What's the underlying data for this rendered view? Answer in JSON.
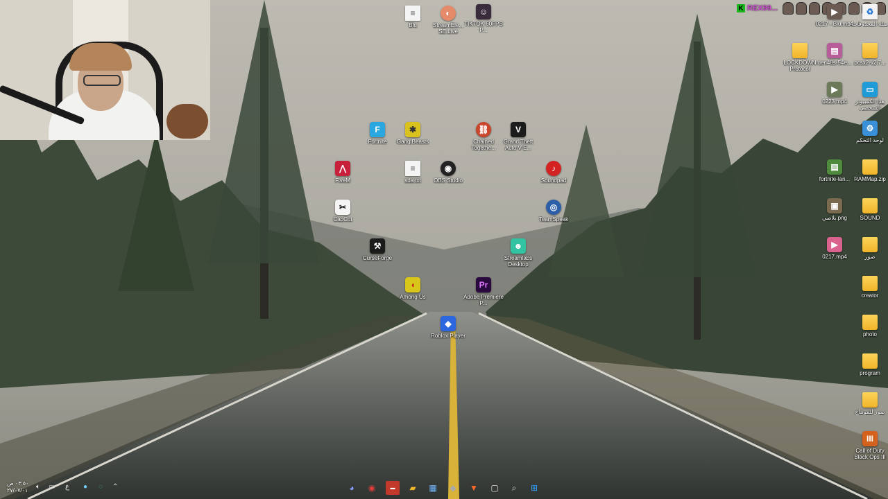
{
  "overlay": {
    "username": "REX99...",
    "badge": "K"
  },
  "desktop_icons": {
    "blu": "Blu",
    "streamelements": "StreamEle... SE.Live",
    "tiktok": "TIKTOK 60FPS P...",
    "fortnite": "Fortnite",
    "gang_beasts": "Gang Beasts",
    "chained": "Chained Togethe...",
    "gta": "Grand Theft Auto V E...",
    "fivem": "FiveM",
    "sda": "sda.txt",
    "obs": "OBS Studio",
    "soundpad": "Soundpad",
    "capcut": "CapCut",
    "teamspeak": "TeamSpeak",
    "curseforge": "CurseForge",
    "streamlabs": "Streamlabs Desktop",
    "among_us": "Among Us",
    "premiere": "Adobe Premiere P...",
    "roblox": "Roblox Player",
    "recycle": "سلة المحذوفات",
    "blu_mp4": "0217 - Blu.mp4",
    "lockdown": "LOCKDOWN Protocol",
    "den": "den48s-54e...",
    "pcsx": "pcsx2-v2.7...",
    "mp4_0223": "0223.mp4",
    "this_pc": "هذا الكمبيوتر الشخصي",
    "control_panel": "لوحة التحكم",
    "fortnite_lan": "fortnite-lan...",
    "rammap": "RAMMap.zip",
    "png": "بلاصي.png",
    "sound": "SOUND",
    "mp4_0217": "0217.mp4",
    "pictures": "صور",
    "creator": "creator",
    "photo": "photo",
    "program": "program",
    "montage": "صور للمونتاج",
    "cod": "Call of Duty Black Ops III"
  },
  "taskbar": {
    "clock_time": "٠٣:٥٠ ص",
    "clock_date": "٢٧/٠٧/٠١",
    "lang": "ع"
  },
  "colors": {
    "accent_green": "#19b51d",
    "username_color": "#d14ad6",
    "folder_yellow": "#f0b429"
  }
}
